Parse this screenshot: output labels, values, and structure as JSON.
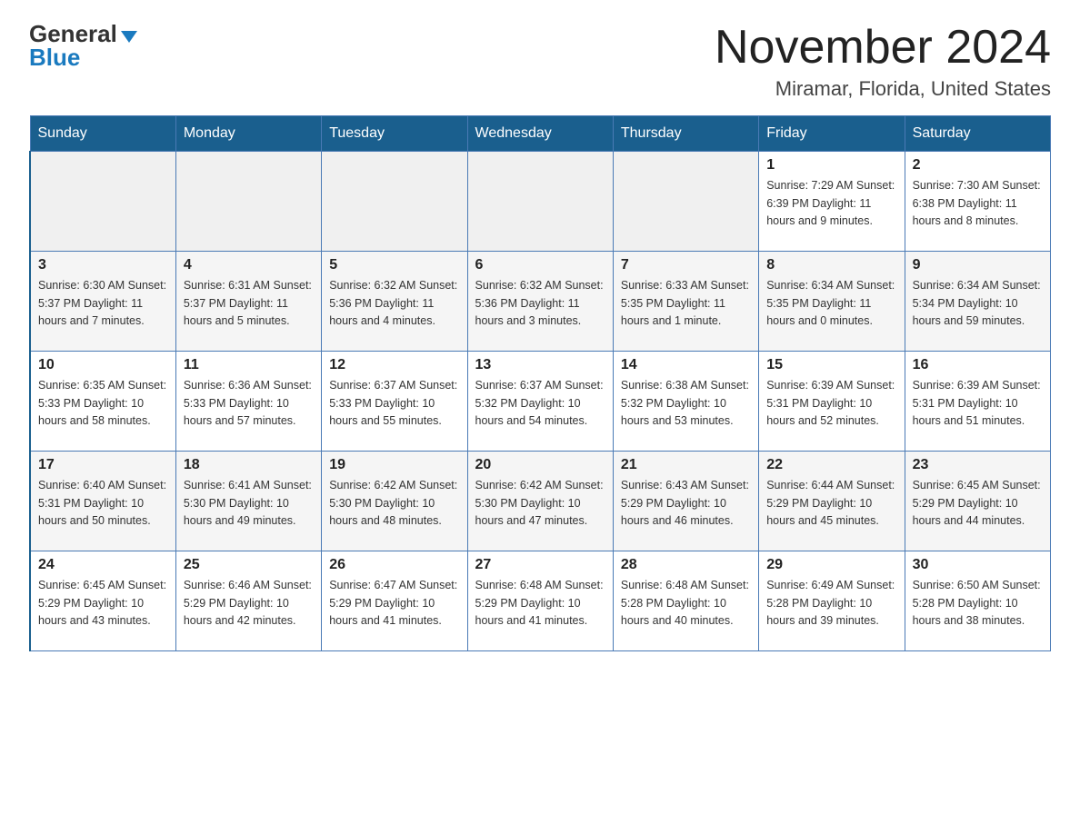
{
  "header": {
    "logo_general": "General",
    "logo_blue": "Blue",
    "title": "November 2024",
    "subtitle": "Miramar, Florida, United States"
  },
  "calendar": {
    "days_of_week": [
      "Sunday",
      "Monday",
      "Tuesday",
      "Wednesday",
      "Thursday",
      "Friday",
      "Saturday"
    ],
    "weeks": [
      [
        {
          "day": "",
          "info": ""
        },
        {
          "day": "",
          "info": ""
        },
        {
          "day": "",
          "info": ""
        },
        {
          "day": "",
          "info": ""
        },
        {
          "day": "",
          "info": ""
        },
        {
          "day": "1",
          "info": "Sunrise: 7:29 AM\nSunset: 6:39 PM\nDaylight: 11 hours and 9 minutes."
        },
        {
          "day": "2",
          "info": "Sunrise: 7:30 AM\nSunset: 6:38 PM\nDaylight: 11 hours and 8 minutes."
        }
      ],
      [
        {
          "day": "3",
          "info": "Sunrise: 6:30 AM\nSunset: 5:37 PM\nDaylight: 11 hours and 7 minutes."
        },
        {
          "day": "4",
          "info": "Sunrise: 6:31 AM\nSunset: 5:37 PM\nDaylight: 11 hours and 5 minutes."
        },
        {
          "day": "5",
          "info": "Sunrise: 6:32 AM\nSunset: 5:36 PM\nDaylight: 11 hours and 4 minutes."
        },
        {
          "day": "6",
          "info": "Sunrise: 6:32 AM\nSunset: 5:36 PM\nDaylight: 11 hours and 3 minutes."
        },
        {
          "day": "7",
          "info": "Sunrise: 6:33 AM\nSunset: 5:35 PM\nDaylight: 11 hours and 1 minute."
        },
        {
          "day": "8",
          "info": "Sunrise: 6:34 AM\nSunset: 5:35 PM\nDaylight: 11 hours and 0 minutes."
        },
        {
          "day": "9",
          "info": "Sunrise: 6:34 AM\nSunset: 5:34 PM\nDaylight: 10 hours and 59 minutes."
        }
      ],
      [
        {
          "day": "10",
          "info": "Sunrise: 6:35 AM\nSunset: 5:33 PM\nDaylight: 10 hours and 58 minutes."
        },
        {
          "day": "11",
          "info": "Sunrise: 6:36 AM\nSunset: 5:33 PM\nDaylight: 10 hours and 57 minutes."
        },
        {
          "day": "12",
          "info": "Sunrise: 6:37 AM\nSunset: 5:33 PM\nDaylight: 10 hours and 55 minutes."
        },
        {
          "day": "13",
          "info": "Sunrise: 6:37 AM\nSunset: 5:32 PM\nDaylight: 10 hours and 54 minutes."
        },
        {
          "day": "14",
          "info": "Sunrise: 6:38 AM\nSunset: 5:32 PM\nDaylight: 10 hours and 53 minutes."
        },
        {
          "day": "15",
          "info": "Sunrise: 6:39 AM\nSunset: 5:31 PM\nDaylight: 10 hours and 52 minutes."
        },
        {
          "day": "16",
          "info": "Sunrise: 6:39 AM\nSunset: 5:31 PM\nDaylight: 10 hours and 51 minutes."
        }
      ],
      [
        {
          "day": "17",
          "info": "Sunrise: 6:40 AM\nSunset: 5:31 PM\nDaylight: 10 hours and 50 minutes."
        },
        {
          "day": "18",
          "info": "Sunrise: 6:41 AM\nSunset: 5:30 PM\nDaylight: 10 hours and 49 minutes."
        },
        {
          "day": "19",
          "info": "Sunrise: 6:42 AM\nSunset: 5:30 PM\nDaylight: 10 hours and 48 minutes."
        },
        {
          "day": "20",
          "info": "Sunrise: 6:42 AM\nSunset: 5:30 PM\nDaylight: 10 hours and 47 minutes."
        },
        {
          "day": "21",
          "info": "Sunrise: 6:43 AM\nSunset: 5:29 PM\nDaylight: 10 hours and 46 minutes."
        },
        {
          "day": "22",
          "info": "Sunrise: 6:44 AM\nSunset: 5:29 PM\nDaylight: 10 hours and 45 minutes."
        },
        {
          "day": "23",
          "info": "Sunrise: 6:45 AM\nSunset: 5:29 PM\nDaylight: 10 hours and 44 minutes."
        }
      ],
      [
        {
          "day": "24",
          "info": "Sunrise: 6:45 AM\nSunset: 5:29 PM\nDaylight: 10 hours and 43 minutes."
        },
        {
          "day": "25",
          "info": "Sunrise: 6:46 AM\nSunset: 5:29 PM\nDaylight: 10 hours and 42 minutes."
        },
        {
          "day": "26",
          "info": "Sunrise: 6:47 AM\nSunset: 5:29 PM\nDaylight: 10 hours and 41 minutes."
        },
        {
          "day": "27",
          "info": "Sunrise: 6:48 AM\nSunset: 5:29 PM\nDaylight: 10 hours and 41 minutes."
        },
        {
          "day": "28",
          "info": "Sunrise: 6:48 AM\nSunset: 5:28 PM\nDaylight: 10 hours and 40 minutes."
        },
        {
          "day": "29",
          "info": "Sunrise: 6:49 AM\nSunset: 5:28 PM\nDaylight: 10 hours and 39 minutes."
        },
        {
          "day": "30",
          "info": "Sunrise: 6:50 AM\nSunset: 5:28 PM\nDaylight: 10 hours and 38 minutes."
        }
      ]
    ]
  }
}
